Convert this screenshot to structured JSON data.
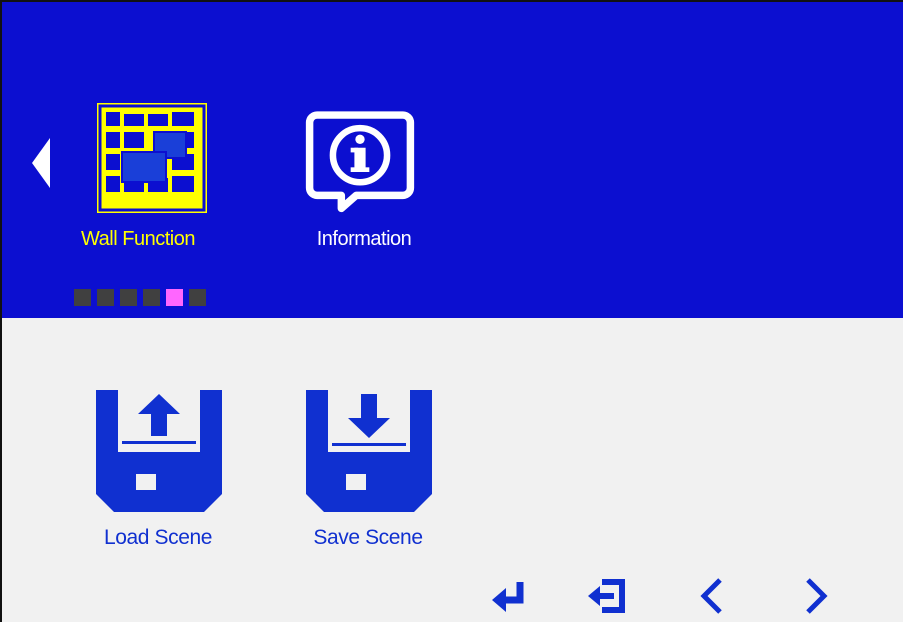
{
  "top_menu": {
    "items": [
      {
        "label": "Wall Function",
        "icon": "wall-function-icon",
        "selected": true
      },
      {
        "label": "Information",
        "icon": "information-icon",
        "selected": false
      }
    ],
    "page_indicator": {
      "count": 6,
      "active_index": 4
    }
  },
  "scene_menu": {
    "items": [
      {
        "label": "Load Scene",
        "icon": "load-scene-icon"
      },
      {
        "label": "Save Scene",
        "icon": "save-scene-icon"
      }
    ]
  },
  "nav_keys": [
    {
      "icon": "enter-icon"
    },
    {
      "icon": "exit-icon"
    },
    {
      "icon": "chevron-left-icon"
    },
    {
      "icon": "chevron-right-icon"
    }
  ],
  "colors": {
    "header_bg": "#0c0fd0",
    "selected_text": "#ffff00",
    "scene_text": "#1030d0",
    "active_dot": "#ff66ff"
  }
}
